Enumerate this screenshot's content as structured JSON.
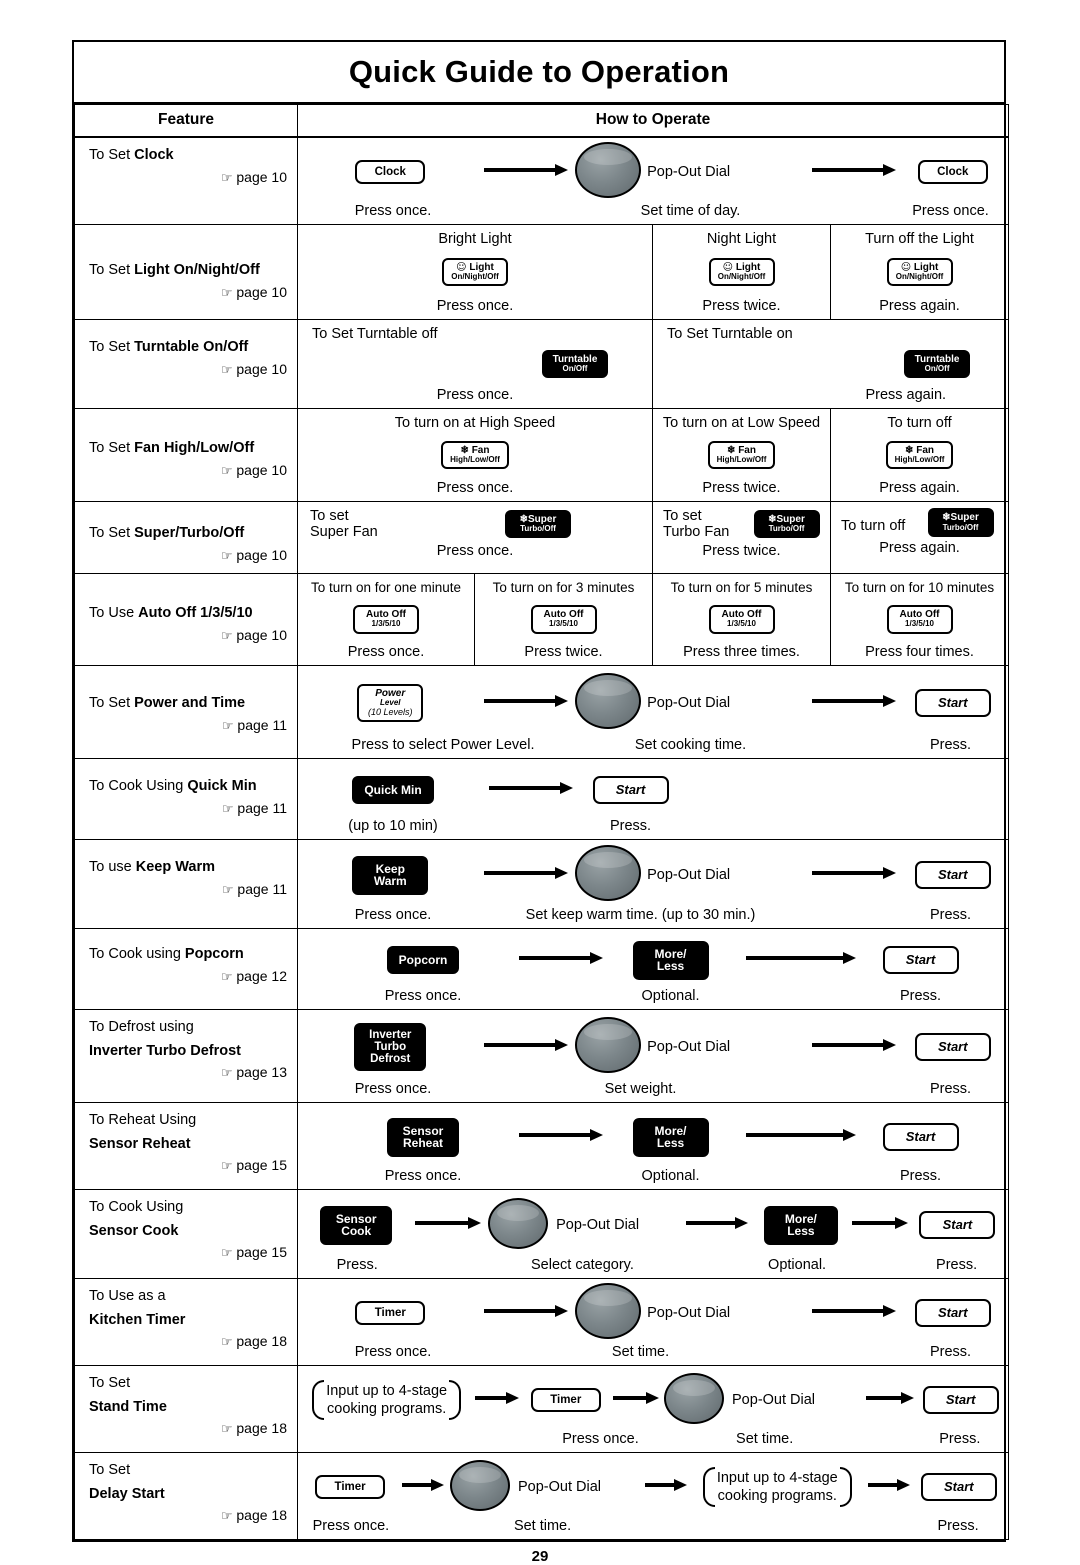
{
  "document": {
    "title": "Quick Guide to Operation",
    "page_number": "29",
    "headers": {
      "feature": "Feature",
      "how_to_operate": "How to Operate"
    }
  },
  "common": {
    "pop_out_dial": "Pop-Out Dial",
    "press": "Press.",
    "press_once": "Press once.",
    "press_twice": "Press twice.",
    "press_again": "Press again.",
    "press_three": "Press three times.",
    "press_four": "Press four times.",
    "optional": "Optional.",
    "start": "Start",
    "more_less_l1": "More/",
    "more_less_l2": "Less",
    "timer": "Timer"
  },
  "rows": [
    {
      "feature_pre": "To Set ",
      "feature_bold": "Clock",
      "page": "page 10",
      "btn1": "Clock",
      "cap1": "Press once.",
      "mid": "Set time of day.",
      "btn2": "Clock",
      "cap2": "Press once."
    },
    {
      "feature_pre": "To Set ",
      "feature_bold": "Light On/Night/Off",
      "page": "page 10",
      "c1_top": "Bright Light",
      "c1_btn_l1": "Light",
      "c1_btn_l2": "On/Night/Off",
      "c1_cap": "Press once.",
      "c2_top": "Night Light",
      "c2_cap": "Press twice.",
      "c3_top": "Turn off the Light",
      "c3_cap": "Press again."
    },
    {
      "feature_pre": "To Set ",
      "feature_bold": "Turntable On/Off",
      "page": "page 10",
      "c1_top": "To Set Turntable off",
      "btn_l1": "Turntable",
      "btn_l2": "On/Off",
      "c1_cap": "Press once.",
      "c2_top": "To Set Turntable on",
      "c2_cap": "Press again."
    },
    {
      "feature_pre": "To Set ",
      "feature_bold": "Fan High/Low/Off",
      "page": "page 10",
      "c1_top": "To turn on at High Speed",
      "btn_l1": "Fan",
      "btn_l2": "High/Low/Off",
      "c1_cap": "Press once.",
      "c2_top": "To turn on at Low Speed",
      "c2_cap": "Press twice.",
      "c3_top": "To turn off",
      "c3_cap": "Press again."
    },
    {
      "feature_pre": "To Set ",
      "feature_bold": "Super/Turbo/Off",
      "page": "page 10",
      "c1_top1": "To set",
      "c1_top2": "Super Fan",
      "btn_l1": "Super",
      "btn_l2": "Turbo/Off",
      "c1_cap": "Press once.",
      "c2_top1": "To set",
      "c2_top2": "Turbo Fan",
      "c2_cap": "Press twice.",
      "c3_top": "To turn off",
      "c3_cap": "Press again."
    },
    {
      "feature_pre": "To Use ",
      "feature_bold": "Auto Off 1/3/5/10",
      "page": "page 10",
      "btn_l1": "Auto Off",
      "btn_l2": "1/3/5/10",
      "c1_top": "To turn on for one minute",
      "c1_cap": "Press once.",
      "c2_top": "To turn on for 3 minutes",
      "c2_cap": "Press twice.",
      "c3_top": "To turn on for 5 minutes",
      "c3_cap": "Press three times.",
      "c4_top": "To turn on for 10 minutes",
      "c4_cap": "Press four times."
    },
    {
      "feature_pre": "To Set ",
      "feature_bold": "Power and Time",
      "page": "page 11",
      "btn_l1": "Power",
      "btn_l2": "Level",
      "btn_l3": "(10 Levels)",
      "cap1": "Press to select Power Level.",
      "mid": "Pop-Out Dial",
      "cap2": "Set cooking time.",
      "btn2": "Start",
      "cap3": "Press."
    },
    {
      "feature_pre": "To Cook Using ",
      "feature_bold": "Quick Min",
      "page": "page 11",
      "btn1": "Quick Min",
      "cap1": "(up to 10 min)",
      "btn2": "Start",
      "cap2": "Press."
    },
    {
      "feature_pre": "To use ",
      "feature_bold": "Keep Warm",
      "page": "page 11",
      "btn_l1": "Keep",
      "btn_l2": "Warm",
      "cap1": "Press once.",
      "mid": "Pop-Out Dial",
      "cap2": "Set keep warm time. (up to 30 min.)",
      "btn2": "Start",
      "cap3": "Press."
    },
    {
      "feature_pre": "To Cook using ",
      "feature_bold": "Popcorn",
      "page": "page 12",
      "btn1": "Popcorn",
      "cap1": "Press once.",
      "cap2": "Optional.",
      "btn3": "Start",
      "cap3": "Press."
    },
    {
      "feature_pre": "To Defrost using",
      "feature_bold": "Inverter Turbo Defrost",
      "page": "page 13",
      "btn_l1": "Inverter",
      "btn_l2": "Turbo",
      "btn_l3": "Defrost",
      "cap1": "Press once.",
      "mid": "Pop-Out Dial",
      "cap2": "Set weight.",
      "btn2": "Start",
      "cap3": "Press."
    },
    {
      "feature_pre": "To Reheat Using",
      "feature_bold": "Sensor Reheat",
      "page": "page 15",
      "btn_l1": "Sensor",
      "btn_l2": "Reheat",
      "cap1": "Press once.",
      "cap2": "Optional.",
      "btn3": "Start",
      "cap3": "Press."
    },
    {
      "feature_pre": "To Cook Using",
      "feature_bold": "Sensor Cook",
      "page": "page 15",
      "btn_l1": "Sensor",
      "btn_l2": "Cook",
      "cap1": "Press.",
      "mid": "Pop-Out Dial",
      "cap2": "Select category.",
      "cap3": "Optional.",
      "btn3": "Start",
      "cap4": "Press."
    },
    {
      "feature_pre": "To Use as a",
      "feature_bold": "Kitchen Timer",
      "page": "page 18",
      "btn1": "Timer",
      "cap1": "Press once.",
      "mid": "Pop-Out Dial",
      "cap2": "Set time.",
      "btn2": "Start",
      "cap3": "Press."
    },
    {
      "feature_pre": "To Set",
      "feature_bold": "Stand Time",
      "page": "page 18",
      "brace_l1": "Input up to 4-stage",
      "brace_l2": "cooking programs.",
      "btn1": "Timer",
      "cap1": "Press once.",
      "mid": "Pop-Out Dial",
      "cap2": "Set time.",
      "btn2": "Start",
      "cap3": "Press."
    },
    {
      "feature_pre": "To Set",
      "feature_bold": "Delay Start",
      "page": "page 18",
      "btn1": "Timer",
      "cap1": "Press once.",
      "mid": "Pop-Out Dial",
      "cap2": "Set time.",
      "brace_l1": "Input up to 4-stage",
      "brace_l2": "cooking programs.",
      "btn2": "Start",
      "cap3": "Press."
    }
  ]
}
